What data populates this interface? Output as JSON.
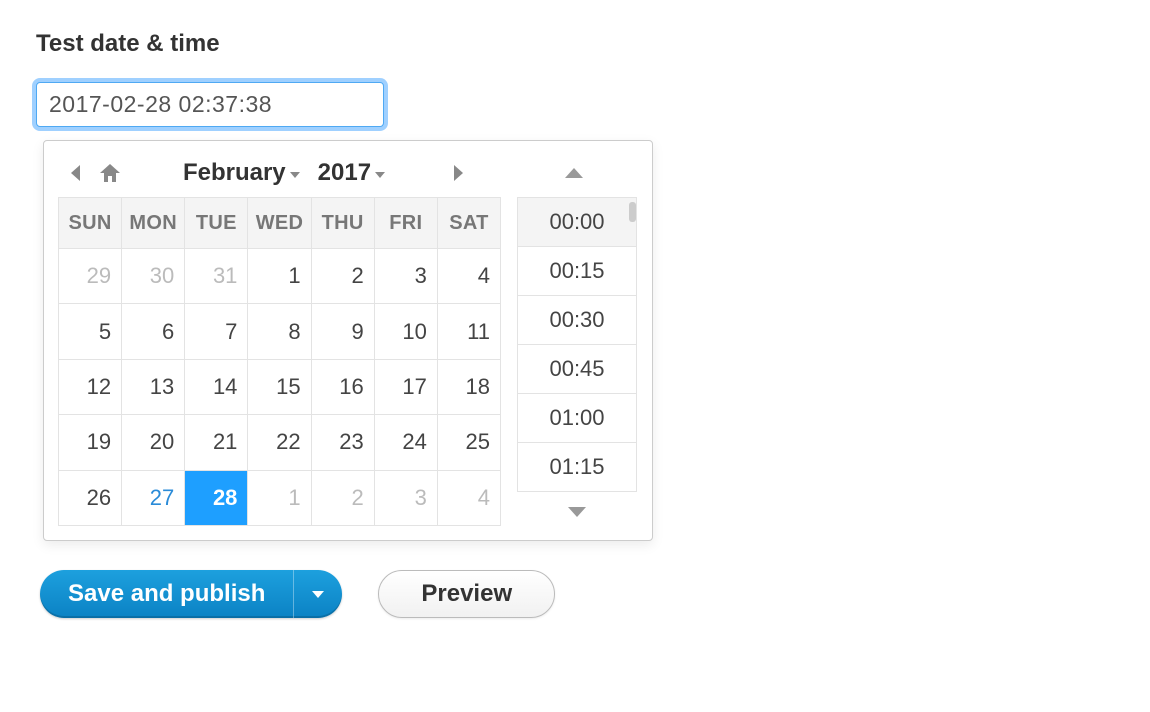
{
  "field": {
    "label": "Test date & time",
    "value": "2017-02-28 02:37:38"
  },
  "picker": {
    "month": "February",
    "year": "2017",
    "dows": [
      "SUN",
      "MON",
      "TUE",
      "WED",
      "THU",
      "FRI",
      "SAT"
    ],
    "weeks": [
      [
        {
          "d": "29",
          "muted": true
        },
        {
          "d": "30",
          "muted": true
        },
        {
          "d": "31",
          "muted": true
        },
        {
          "d": "1"
        },
        {
          "d": "2"
        },
        {
          "d": "3"
        },
        {
          "d": "4"
        }
      ],
      [
        {
          "d": "5"
        },
        {
          "d": "6"
        },
        {
          "d": "7"
        },
        {
          "d": "8"
        },
        {
          "d": "9"
        },
        {
          "d": "10"
        },
        {
          "d": "11"
        }
      ],
      [
        {
          "d": "12"
        },
        {
          "d": "13"
        },
        {
          "d": "14"
        },
        {
          "d": "15"
        },
        {
          "d": "16"
        },
        {
          "d": "17"
        },
        {
          "d": "18"
        }
      ],
      [
        {
          "d": "19"
        },
        {
          "d": "20"
        },
        {
          "d": "21"
        },
        {
          "d": "22"
        },
        {
          "d": "23"
        },
        {
          "d": "24"
        },
        {
          "d": "25"
        }
      ],
      [
        {
          "d": "26"
        },
        {
          "d": "27",
          "today": true
        },
        {
          "d": "28",
          "selected": true
        },
        {
          "d": "1",
          "muted": true
        },
        {
          "d": "2",
          "muted": true
        },
        {
          "d": "3",
          "muted": true
        },
        {
          "d": "4",
          "muted": true
        }
      ]
    ],
    "times": [
      "00:00",
      "00:15",
      "00:30",
      "00:45",
      "01:00",
      "01:15"
    ]
  },
  "buttons": {
    "primary": "Save and publish",
    "secondary": "Preview"
  }
}
